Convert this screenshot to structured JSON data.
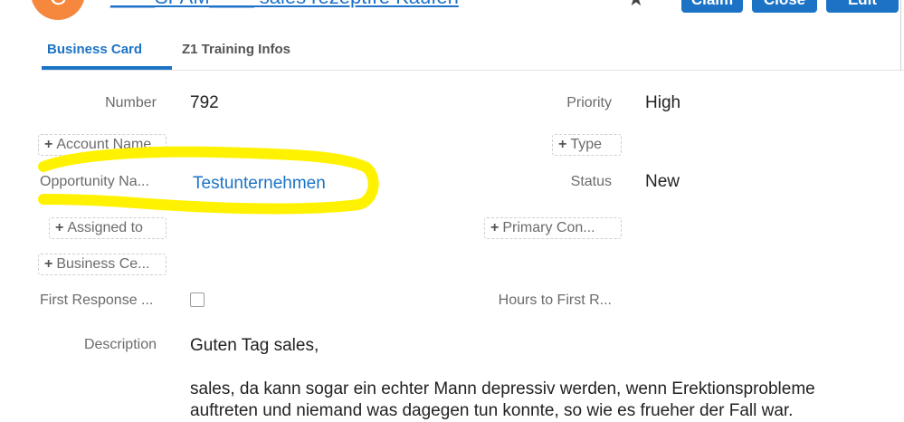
{
  "header": {
    "avatar_letter": "C",
    "title": "____SPAM____ sales rezeptfre Kaufen",
    "buttons": {
      "claim": "Claim",
      "close": "Close",
      "edit": "Edit"
    }
  },
  "tabs": [
    {
      "label": "Business Card"
    },
    {
      "label": "Z1 Training Infos"
    }
  ],
  "fields": {
    "number_label": "Number",
    "number_value": "792",
    "priority_label": "Priority",
    "priority_value": "High",
    "account_name_label": "Account Name",
    "type_label": "Type",
    "opportunity_label": "Opportunity Na...",
    "opportunity_value": "Testunternehmen",
    "status_label": "Status",
    "status_value": "New",
    "assigned_to_label": "Assigned to",
    "primary_contact_label": "Primary Con...",
    "business_center_label": "Business Ce...",
    "first_response_label": "First Response ...",
    "hours_first_label": "Hours to First R...",
    "description_label": "Description",
    "description_value": "Guten Tag sales,\n\nsales, da kann sogar ein echter Mann depressiv werden, wenn Erektionsprobleme\nauftreten und niemand was dagegen tun konnte, so wie es frueher der Fall war."
  },
  "colors": {
    "accent": "#1c73c6",
    "avatar": "#f5883c",
    "highlight": "#fff200"
  }
}
